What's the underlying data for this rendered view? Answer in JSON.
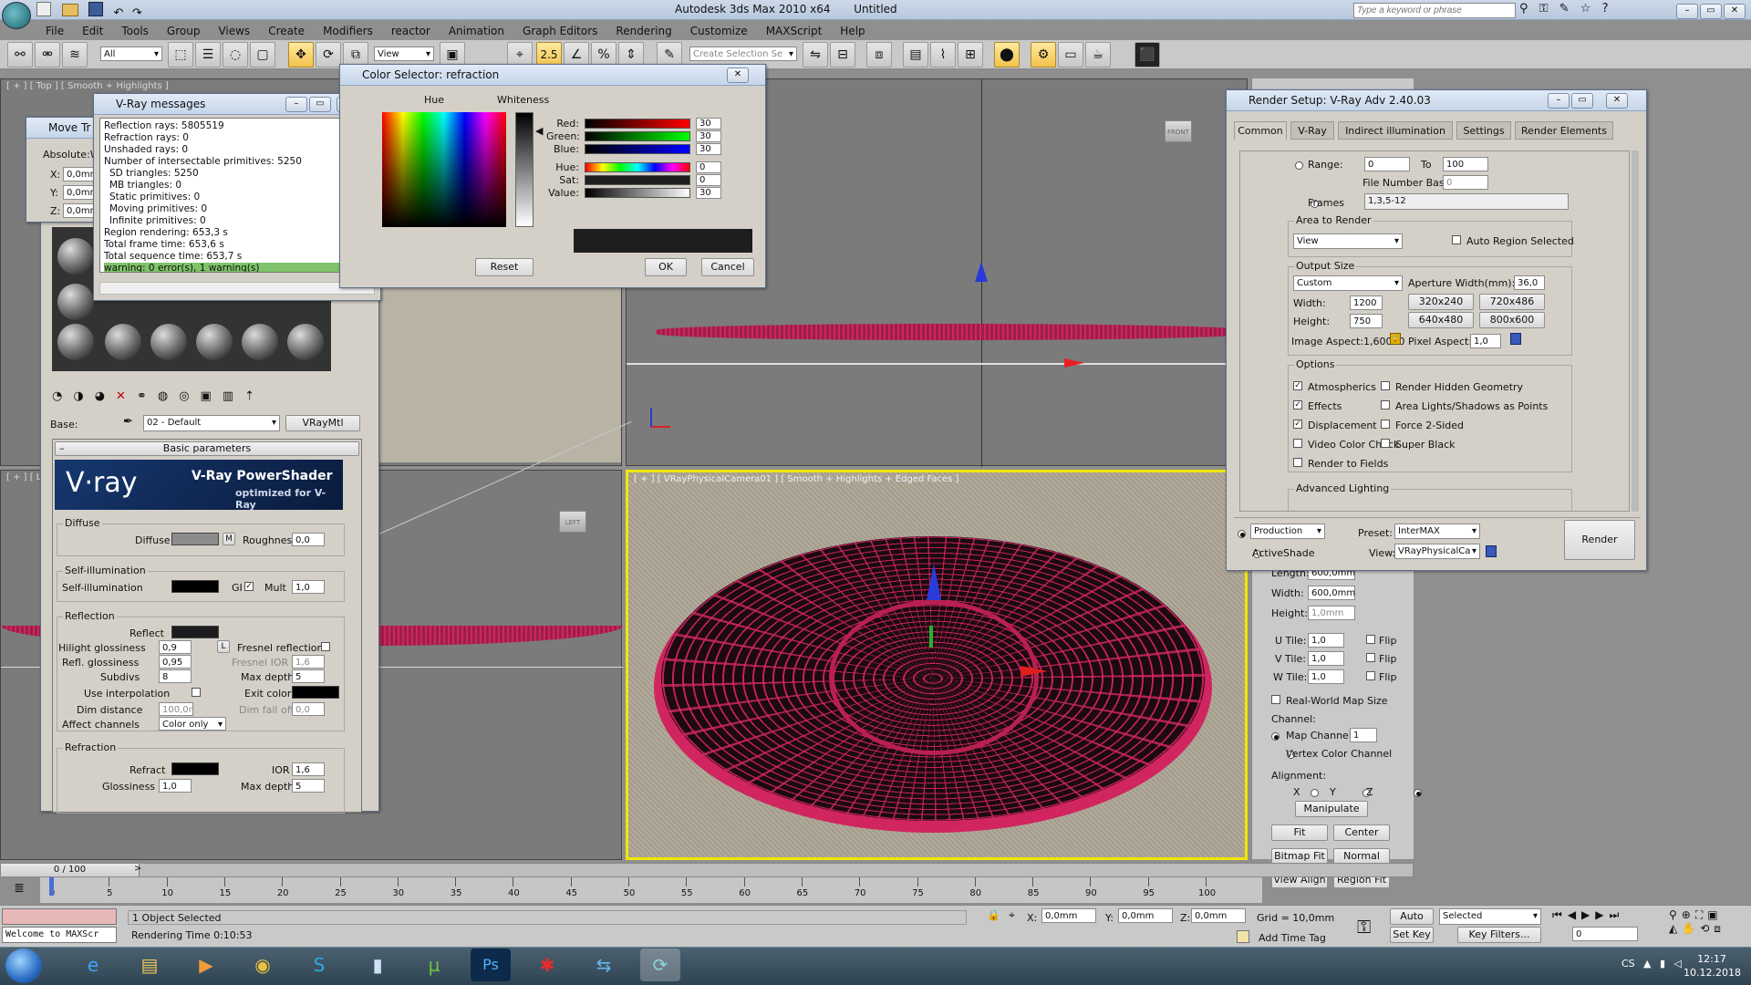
{
  "app": {
    "title": "Autodesk 3ds Max 2010 x64",
    "doc": "Untitled",
    "search_placeholder": "Type a keyword or phrase"
  },
  "menu": [
    "File",
    "Edit",
    "Tools",
    "Group",
    "Views",
    "Create",
    "Modifiers",
    "reactor",
    "Animation",
    "Graph Editors",
    "Rendering",
    "Customize",
    "MAXScript",
    "Help"
  ],
  "toolbar": {
    "filter": "All",
    "refcoord": "View",
    "snap": "2.5",
    "selset_placeholder": "Create Selection Se"
  },
  "viewports": {
    "top_label": "[ + ] [ Top ] [ Smooth + Highlights ]",
    "left_label": "[ + ] [ L",
    "camera_label": "[ + ] [ VRayPhysicalCamera01 ] [ Smooth + Highlights + Edged Faces ]",
    "front_gizmo": "FRONT",
    "left_gizmo": "LEFT"
  },
  "move_dialog": {
    "title": "Move Tr",
    "abs_label": "Absolute:W",
    "x_label": "X:",
    "y_label": "Y:",
    "z_label": "Z:",
    "val": "0,0mm"
  },
  "vray_messages": {
    "title": "V-Ray messages",
    "lines": [
      "Reflection rays: 5805519",
      "Refraction rays: 0",
      "Unshaded rays: 0",
      "Number of intersectable primitives: 5250",
      "SD triangles: 5250",
      "MB triangles: 0",
      "Static primitives: 0",
      "Moving primitives: 0",
      "Infinite primitives: 0",
      "Region rendering: 653,3 s",
      "Total frame time: 653,6 s",
      "Total sequence time: 653,7 s"
    ],
    "warning": "warning: 0 error(s), 1 warning(s)",
    "separator": "=============================="
  },
  "color_selector": {
    "title": "Color Selector: refraction",
    "hue_label": "Hue",
    "whiteness_label": "Whiteness",
    "rows": [
      {
        "label": "Red:",
        "value": "30"
      },
      {
        "label": "Green:",
        "value": "30"
      },
      {
        "label": "Blue:",
        "value": "30"
      },
      {
        "label": "Hue:",
        "value": "0"
      },
      {
        "label": "Sat:",
        "value": "0"
      },
      {
        "label": "Value:",
        "value": "30"
      }
    ],
    "reset": "Reset",
    "ok": "OK",
    "cancel": "Cancel"
  },
  "material_editor": {
    "base_label": "Base:",
    "material_name": "02 - Default",
    "material_type": "VRayMtl",
    "basic_params": "Basic parameters",
    "brand": "V·ray",
    "powershader": "V-Ray PowerShader",
    "optimized": "optimized for V-Ray",
    "diffuse_group": "Diffuse",
    "diffuse_label": "Diffuse",
    "diffuse_map": "M",
    "roughness_label": "Roughness",
    "roughness": "0,0",
    "selfillum_group": "Self-illumination",
    "selfillum_label": "Self-illumination",
    "gi_label": "GI",
    "mult_label": "Mult",
    "mult": "1,0",
    "reflection_group": "Reflection",
    "reflect_label": "Reflect",
    "hilight_label": "Hilight glossiness",
    "hilight": "0,9",
    "l_label": "L",
    "fresnel_label": "Fresnel reflections",
    "refl_gloss_label": "Refl. glossiness",
    "refl_gloss": "0,95",
    "fresnel_ior_label": "Fresnel IOR",
    "fresnel_ior": "1,6",
    "subdivs_label": "Subdivs",
    "subdivs": "8",
    "max_depth_label": "Max depth",
    "max_depth": "5",
    "use_interp_label": "Use interpolation",
    "exit_color_label": "Exit color",
    "dim_distance_label": "Dim distance",
    "dim_distance": "100,0n",
    "dim_falloff_label": "Dim fall off",
    "dim_falloff": "0,0",
    "affect_label": "Affect channels",
    "affect": "Color only",
    "refraction_group": "Refraction",
    "refract_label": "Refract",
    "ior_label": "IOR",
    "ior": "1,6",
    "glossiness_label": "Glossiness",
    "glossiness": "1,0",
    "refr_max_depth_label": "Max depth",
    "refr_max_depth": "5"
  },
  "render_setup": {
    "title": "Render Setup: V-Ray Adv 2.40.03",
    "tabs": [
      "Common",
      "V-Ray",
      "Indirect illumination",
      "Settings",
      "Render Elements"
    ],
    "range_label": "Range:",
    "range_from": "0",
    "to_label": "To",
    "range_to": "100",
    "file_number_label": "File Number Base:",
    "file_number": "0",
    "frames_label": "Frames",
    "frames": "1,3,5-12",
    "area_group": "Area to Render",
    "area": "View",
    "auto_region": "Auto Region Selected",
    "output_group": "Output Size",
    "output": "Custom",
    "aperture_label": "Aperture Width(mm):",
    "aperture": "36,0",
    "width_label": "Width:",
    "width": "1200",
    "height_label": "Height:",
    "height": "750",
    "presets": [
      "320x240",
      "720x486",
      "640x480",
      "800x600"
    ],
    "image_aspect": "Image Aspect:1,60000",
    "pixel_aspect_label": "Pixel Aspect:",
    "pixel_aspect": "1,0",
    "options_group": "Options",
    "options_left": [
      {
        "label": "Atmospherics",
        "checked": true
      },
      {
        "label": "Effects",
        "checked": true
      },
      {
        "label": "Displacement",
        "checked": true
      },
      {
        "label": "Video Color Check",
        "checked": false
      },
      {
        "label": "Render to Fields",
        "checked": false
      }
    ],
    "options_right": [
      {
        "label": "Render Hidden Geometry",
        "checked": false
      },
      {
        "label": "Area Lights/Shadows as Points",
        "checked": false
      },
      {
        "label": "Force 2-Sided",
        "checked": false
      },
      {
        "label": "Super Black",
        "checked": false
      }
    ],
    "advanced_lighting": "Advanced Lighting",
    "production": "Production",
    "activeshade": "ActiveShade",
    "preset_label": "Preset:",
    "preset": "InterMAX",
    "view_label": "View:",
    "view": "VRayPhysicalCa",
    "render": "Render"
  },
  "cmd_panel": {
    "length_label": "Length:",
    "length": "600,0mm",
    "width_label": "Width:",
    "width": "600,0mm",
    "height_label": "Height:",
    "height": "1,0mm",
    "utile_label": "U Tile:",
    "utile": "1,0",
    "vtile_label": "V Tile:",
    "vtile": "1,0",
    "wtile_label": "W Tile:",
    "wtile": "1,0",
    "flip": "Flip",
    "realworld": "Real-World Map Size",
    "channel_group": "Channel:",
    "map_channel_label": "Map Channel:",
    "map_channel": "1",
    "vertex_color": "Vertex Color Channel",
    "alignment_group": "Alignment:",
    "ax": "X",
    "ay": "Y",
    "az": "Z",
    "manipulate": "Manipulate",
    "fit": "Fit",
    "center": "Center",
    "bitmap_fit": "Bitmap Fit",
    "normal_align": "Normal Align",
    "view_align": "View Align",
    "region_fit": "Region Fit"
  },
  "timeline": {
    "frame": "0 / 100",
    "ticks": [
      "0",
      "5",
      "10",
      "15",
      "20",
      "25",
      "30",
      "35",
      "40",
      "45",
      "50",
      "55",
      "60",
      "65",
      "70",
      "75",
      "80",
      "85",
      "90",
      "95",
      "100"
    ]
  },
  "status": {
    "maxscript": "Welcome to MAXScr",
    "selected": "1 Object Selected",
    "render_time": "Rendering Time  0:10:53",
    "x": "0,0mm",
    "y": "0,0mm",
    "z": "0,0mm",
    "grid": "Grid = 10,0mm",
    "add_time_tag": "Add Time Tag",
    "auto_key": "Auto Key",
    "set_key": "Set Key",
    "selected_set": "Selected",
    "key_filters": "Key Filters...",
    "frame_field": "0"
  },
  "taskbar": {
    "lang": "CS",
    "time": "12:17",
    "date": "10.12.2018"
  },
  "colors": {
    "wire": "#d0255f",
    "vray_blue": "#0f2a5c",
    "viewport_bg": "#7e7e7e",
    "active_border": "#f2e600"
  }
}
